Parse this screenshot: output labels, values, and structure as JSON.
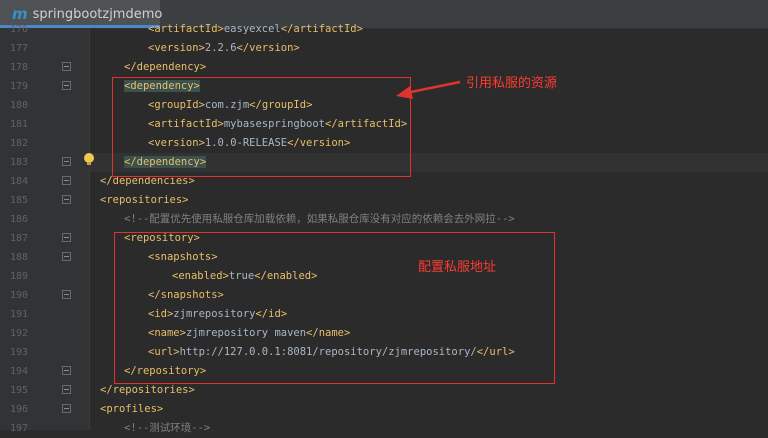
{
  "tab": {
    "icon": "maven-m-icon",
    "icon_letter": "m",
    "title": "springbootzjmdemo"
  },
  "lines": [
    {
      "num": "176",
      "code": "<artifactId>easyexcel</artifactId>"
    },
    {
      "num": "177",
      "code": "<version>2.2.6</version>"
    },
    {
      "num": "178",
      "code": "</dependency>"
    },
    {
      "num": "179",
      "code": "<dependency>"
    },
    {
      "num": "180",
      "code": "<groupId>com.zjm</groupId>"
    },
    {
      "num": "181",
      "code": "<artifactId>mybasespringboot</artifactId>"
    },
    {
      "num": "182",
      "code": "<version>1.0.0-RELEASE</version>"
    },
    {
      "num": "183",
      "code": "</dependency>"
    },
    {
      "num": "184",
      "code": "</dependencies>"
    },
    {
      "num": "185",
      "code": "<repositories>"
    },
    {
      "num": "186",
      "code": "<!--配置优先使用私服仓库加载依赖，如果私服仓库没有对应的依赖会去外网拉-->"
    },
    {
      "num": "187",
      "code": "<repository>"
    },
    {
      "num": "188",
      "code": "<snapshots>"
    },
    {
      "num": "189",
      "code": "<enabled>true</enabled>"
    },
    {
      "num": "190",
      "code": "</snapshots>"
    },
    {
      "num": "191",
      "code": "<id>zjmrepository</id>"
    },
    {
      "num": "192",
      "code": "<name>zjmrepository maven</name>"
    },
    {
      "num": "193",
      "code": "<url>http://127.0.0.1:8081/repository/zjmrepository/</url>"
    },
    {
      "num": "194",
      "code": "</repository>"
    },
    {
      "num": "195",
      "code": "</repositories>"
    },
    {
      "num": "196",
      "code": "<profiles>"
    },
    {
      "num": "197",
      "code": "<!--测试环境-->"
    }
  ],
  "annotations": {
    "dependency_note": "引用私服的资源",
    "repository_note": "配置私服地址"
  },
  "colors": {
    "annotation": "#e0322e",
    "tag": "#e8bf6a",
    "text": "#a9b7c6",
    "comment": "#808080"
  }
}
